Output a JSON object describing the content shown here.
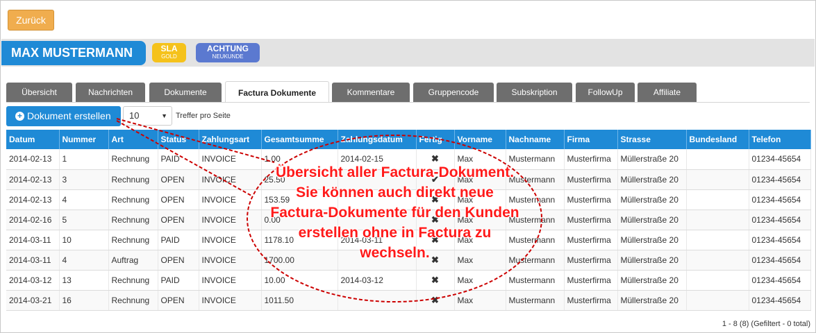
{
  "nav": {
    "back_label": "Zurück"
  },
  "customer": {
    "name": "MAX MUSTERMANN",
    "badges": [
      {
        "title": "SLA",
        "sub": "GOLD",
        "color": "#f5c21b"
      },
      {
        "title": "ACHTUNG",
        "sub": "NEUKUNDE",
        "color": "#5b79d0"
      }
    ]
  },
  "tabs": [
    {
      "label": "Übersicht"
    },
    {
      "label": "Nachrichten"
    },
    {
      "label": "Dokumente"
    },
    {
      "label": "Factura Dokumente",
      "active": true
    },
    {
      "label": "Kommentare"
    },
    {
      "label": "Gruppencode"
    },
    {
      "label": "Subskription"
    },
    {
      "label": "FollowUp"
    },
    {
      "label": "Affiliate"
    }
  ],
  "toolbar": {
    "new_doc_label": "Dokument erstellen",
    "page_size_value": "10",
    "page_size_label": "Treffer pro Seite"
  },
  "table": {
    "columns": [
      "Datum",
      "Nummer",
      "Art",
      "Status",
      "Zahlungsart",
      "Gesamtsumme",
      "Zahlungsdatum",
      "Fertig",
      "Vorname",
      "Nachname",
      "Firma",
      "Strasse",
      "Bundesland",
      "Telefon"
    ],
    "rows": [
      [
        "2014-02-13",
        "1",
        "Rechnung",
        "PAID",
        "INVOICE",
        "1.00",
        "2014-02-15",
        "✖",
        "Max",
        "Mustermann",
        "Musterfirma",
        "Müllerstraße 20",
        "",
        "01234-45654"
      ],
      [
        "2014-02-13",
        "3",
        "Rechnung",
        "OPEN",
        "INVOICE",
        "25.50",
        "",
        "✔",
        "Max",
        "Mustermann",
        "Musterfirma",
        "Müllerstraße 20",
        "",
        "01234-45654"
      ],
      [
        "2014-02-13",
        "4",
        "Rechnung",
        "OPEN",
        "INVOICE",
        "153.59",
        "",
        "✖",
        "Max",
        "Mustermann",
        "Musterfirma",
        "Müllerstraße 20",
        "",
        "01234-45654"
      ],
      [
        "2014-02-16",
        "5",
        "Rechnung",
        "OPEN",
        "INVOICE",
        "0.00",
        "",
        "✖",
        "Max",
        "Mustermann",
        "Musterfirma",
        "Müllerstraße 20",
        "",
        "01234-45654"
      ],
      [
        "2014-03-11",
        "10",
        "Rechnung",
        "PAID",
        "INVOICE",
        "1178.10",
        "2014-03-11",
        "✖",
        "Max",
        "Mustermann",
        "Musterfirma",
        "Müllerstraße 20",
        "",
        "01234-45654"
      ],
      [
        "2014-03-11",
        "4",
        "Auftrag",
        "OPEN",
        "INVOICE",
        "1700.00",
        "",
        "✖",
        "Max",
        "Mustermann",
        "Musterfirma",
        "Müllerstraße 20",
        "",
        "01234-45654"
      ],
      [
        "2014-03-12",
        "13",
        "Rechnung",
        "PAID",
        "INVOICE",
        "10.00",
        "2014-03-12",
        "✖",
        "Max",
        "Mustermann",
        "Musterfirma",
        "Müllerstraße 20",
        "",
        "01234-45654"
      ],
      [
        "2014-03-21",
        "16",
        "Rechnung",
        "OPEN",
        "INVOICE",
        "1011.50",
        "",
        "✖",
        "Max",
        "Mustermann",
        "Musterfirma",
        "Müllerstraße 20",
        "",
        "01234-45654"
      ]
    ]
  },
  "footer": {
    "summary": "1 - 8 (8) (Gefiltert - 0 total)"
  },
  "annotation": {
    "text": "Übersicht aller Factura-Dokument. Sie können auch direkt neue Factura-Dokumente für den Kunden erstellen ohne in Factura zu wechseln.",
    "color": "#ff1a1a"
  }
}
